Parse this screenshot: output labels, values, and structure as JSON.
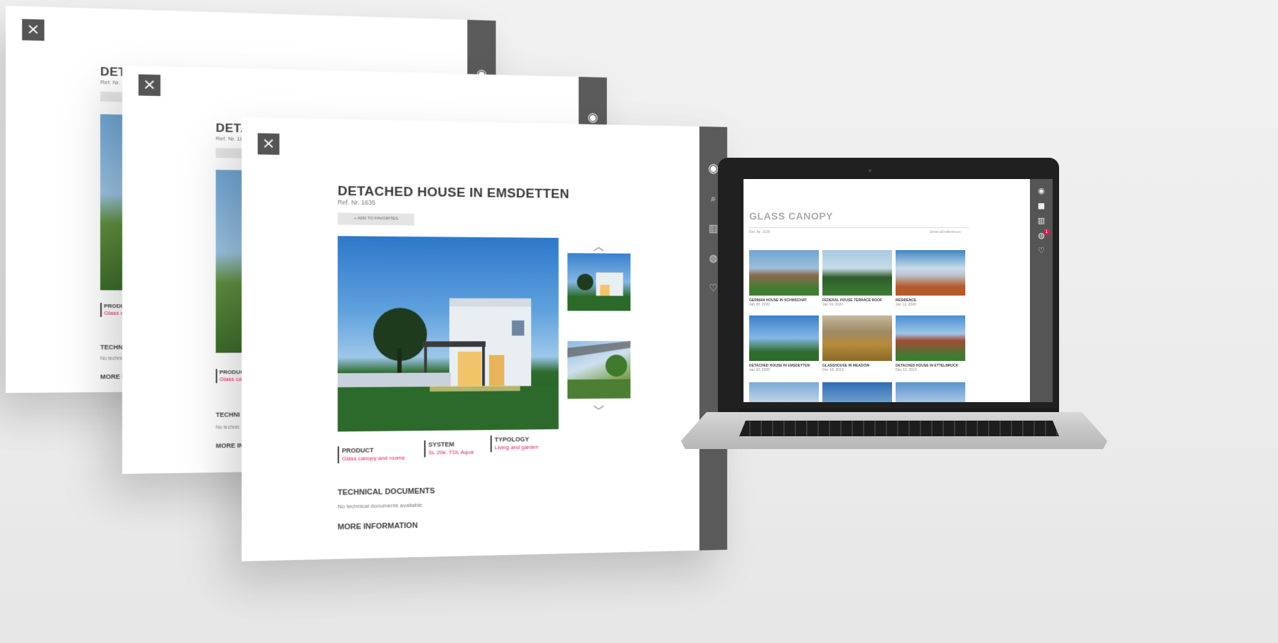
{
  "back_panels": [
    {
      "close": "×",
      "title": "DETA",
      "ref": "Ref. Nr. 16",
      "label_head": "PRODUC",
      "label_value": "Glass ca",
      "tech_head": "TECHNI",
      "tech_text": "No technic",
      "more_head": "MORE IN"
    },
    {
      "close": "×",
      "title": "DETA",
      "ref": "Ref. Nr. 16",
      "label_head": "PRODUC",
      "label_value": "Glass can",
      "tech_head": "TECHNI",
      "tech_text": "No technic",
      "more_head": "MORE IN"
    }
  ],
  "front_panel": {
    "close": "×",
    "title": "DETACHED HOUSE IN EMSDETTEN",
    "ref": "Ref. Nr. 1635",
    "add_button": "+  ADD TO FAVORITES",
    "up_arrow": "︿",
    "down_arrow": "﹀",
    "attributes": [
      {
        "head": "PRODUCT",
        "value": "Glass canopy and rooms"
      },
      {
        "head": "SYSTEM",
        "value": "SL 20e, TDL Aqua"
      },
      {
        "head": "TYPOLOGY",
        "value": "Living and garden"
      }
    ],
    "tech_head": "TECHNICAL DOCUMENTS",
    "tech_text": "No technical documents available.",
    "more_head": "MORE INFORMATION",
    "rail_icons": [
      "user-icon",
      "search-icon",
      "building-icon",
      "globe-icon",
      "heart-icon"
    ],
    "rail_glyphs": [
      "◉",
      "⌕",
      "▥",
      "◍",
      "♡"
    ]
  },
  "laptop": {
    "title": "GLASS CANOPY",
    "subtitle_left": "Ref. Nr. 1635",
    "subtitle_right": "Show all references",
    "rail_glyphs": [
      "◉",
      "■",
      "▥",
      "◍",
      "♡"
    ],
    "badge": "1",
    "tiles": [
      {
        "name": "GERMAN HOUSE IN SCHWECHAT",
        "date": "Jan 20, 2020"
      },
      {
        "name": "FEDERAL HOUSE TERRACE ROOF",
        "date": "Jan 14, 2020"
      },
      {
        "name": "RESIDENCE",
        "date": "Jan 12, 2020"
      },
      {
        "name": "DETACHED HOUSE IN EMSDETTEN",
        "date": "Jan 10, 2020"
      },
      {
        "name": "GLASSHOUSE IN MEADOW",
        "date": "Dec 18, 2019"
      },
      {
        "name": "DETACHED HOUSE IN ETTELBRUCK",
        "date": "Dec 12, 2019"
      }
    ]
  }
}
